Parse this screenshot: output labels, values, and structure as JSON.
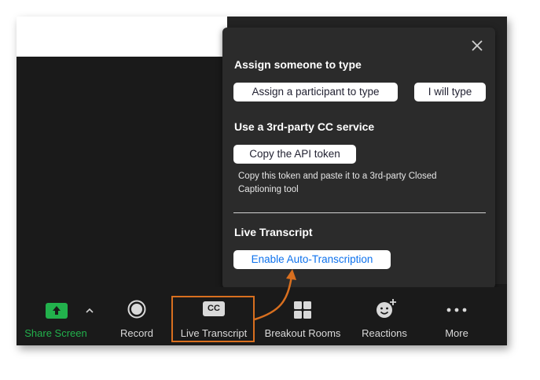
{
  "popup": {
    "assign_section": {
      "title": "Assign someone to type",
      "assign_participant_label": "Assign a participant to type",
      "i_will_type_label": "I will type"
    },
    "third_party_section": {
      "title": "Use a 3rd-party CC service",
      "copy_token_label": "Copy the API token",
      "description_line1": "Copy this token and paste it to a 3rd-party Closed",
      "description_line2": "Captioning tool"
    },
    "live_transcript_section": {
      "title": "Live Transcript",
      "enable_label": "Enable Auto-Transcription"
    },
    "close_icon": "close-icon"
  },
  "toolbar": {
    "share_screen": {
      "label": "Share Screen",
      "icon": "share-screen-icon",
      "color": "#22b14c"
    },
    "record": {
      "label": "Record",
      "icon": "record-icon"
    },
    "live_transcript": {
      "label": "Live Transcript",
      "icon": "cc-icon",
      "icon_text": "CC"
    },
    "breakout_rooms": {
      "label": "Breakout Rooms",
      "icon": "breakout-rooms-icon"
    },
    "reactions": {
      "label": "Reactions",
      "icon": "reactions-icon"
    },
    "more": {
      "label": "More",
      "icon": "more-icon"
    }
  },
  "colors": {
    "highlight": "#d86f1f",
    "link_blue": "#0e72ed",
    "share_green": "#22b14c"
  }
}
